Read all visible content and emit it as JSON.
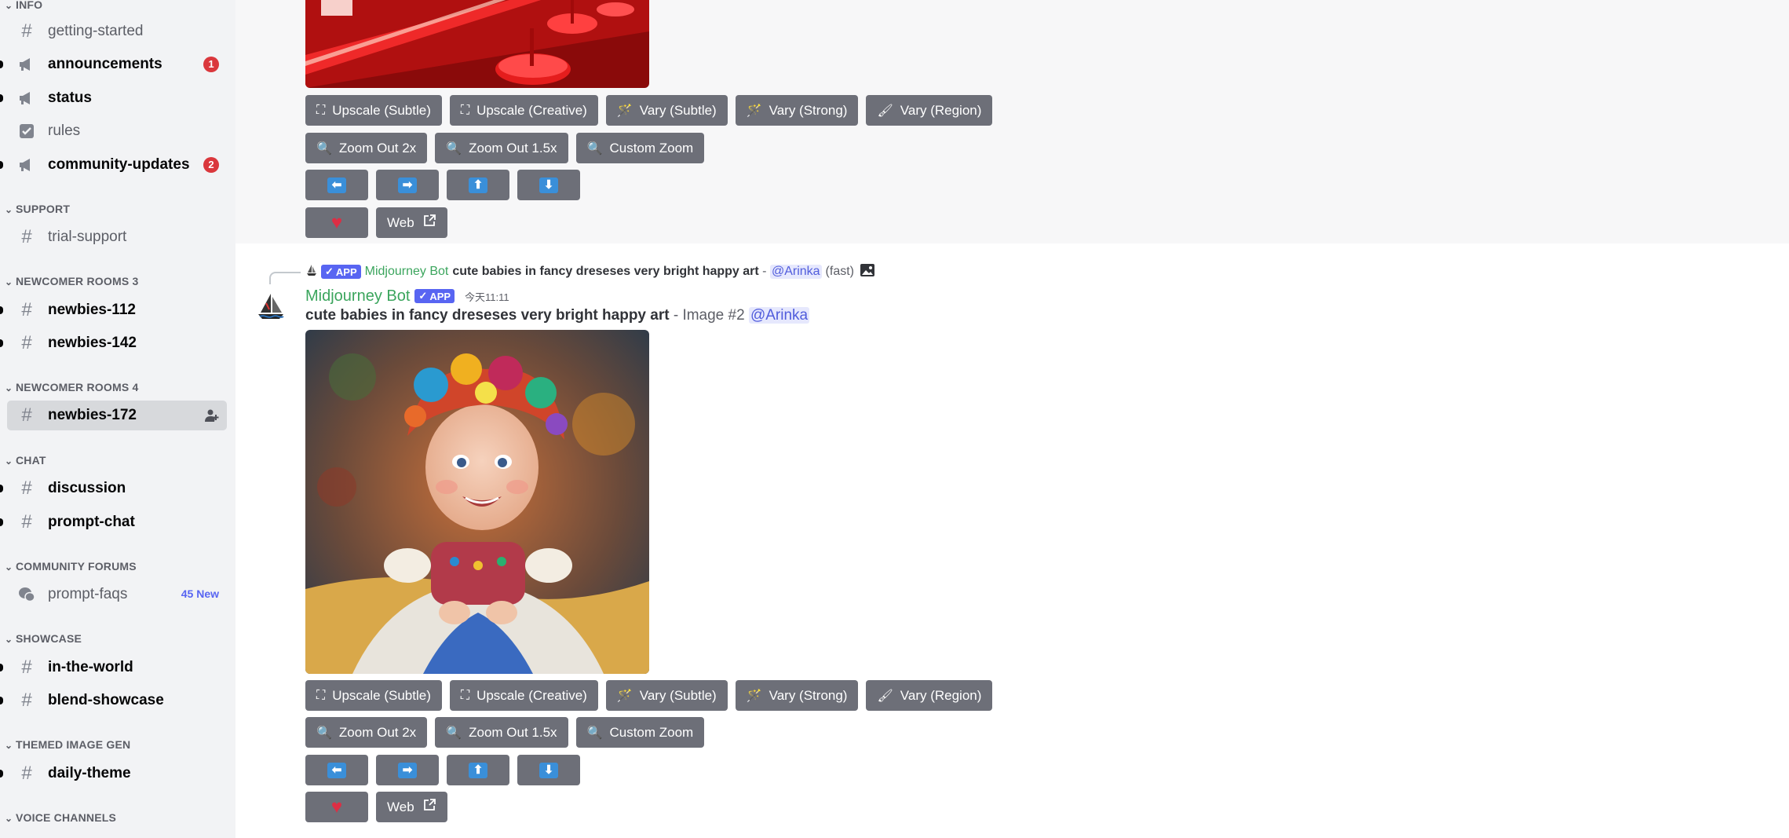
{
  "sidebar": {
    "categories": [
      {
        "label": "INFO"
      },
      {
        "label": "SUPPORT"
      },
      {
        "label": "NEWCOMER ROOMS 3"
      },
      {
        "label": "NEWCOMER ROOMS 4"
      },
      {
        "label": "CHAT"
      },
      {
        "label": "COMMUNITY FORUMS"
      },
      {
        "label": "SHOWCASE"
      },
      {
        "label": "THEMED IMAGE GEN"
      },
      {
        "label": "VOICE CHANNELS"
      }
    ],
    "channels": [
      {
        "name": "getting-started",
        "icon": "hash-icon"
      },
      {
        "name": "announcements",
        "icon": "megaphone-icon",
        "badge": "1"
      },
      {
        "name": "status",
        "icon": "megaphone-icon"
      },
      {
        "name": "rules",
        "icon": "checkbox-icon"
      },
      {
        "name": "community-updates",
        "icon": "megaphone-icon",
        "badge": "2"
      },
      {
        "name": "trial-support",
        "icon": "hash-icon"
      },
      {
        "name": "newbies-112",
        "icon": "hash-icon"
      },
      {
        "name": "newbies-142",
        "icon": "hash-icon"
      },
      {
        "name": "newbies-172",
        "icon": "hash-icon",
        "selected": true
      },
      {
        "name": "discussion",
        "icon": "hash-icon"
      },
      {
        "name": "prompt-chat",
        "icon": "hash-icon"
      },
      {
        "name": "prompt-faqs",
        "icon": "forum-icon",
        "new_tag": "45 New"
      },
      {
        "name": "in-the-world",
        "icon": "hash-icon"
      },
      {
        "name": "blend-showcase",
        "icon": "hash-icon"
      },
      {
        "name": "daily-theme",
        "icon": "hash-icon"
      }
    ]
  },
  "buttons": {
    "upscale_subtle": "Upscale (Subtle)",
    "upscale_creative": "Upscale (Creative)",
    "vary_subtle": "Vary (Subtle)",
    "vary_strong": "Vary (Strong)",
    "vary_region": "Vary (Region)",
    "zoom_out_2x": "Zoom Out 2x",
    "zoom_out_1_5x": "Zoom Out 1.5x",
    "custom_zoom": "Custom Zoom",
    "web": "Web"
  },
  "message2": {
    "reply": {
      "bot_name": "Midjourney Bot",
      "app_tag": "APP",
      "prompt": "cute babies in fancy dreseses very bright happy art",
      "separator": " - ",
      "mention": "@Arinka",
      "speed": "(fast)"
    },
    "author": "Midjourney Bot",
    "app_tag": "APP",
    "timestamp": "今天11:11",
    "prompt": "cute babies in fancy dreseses very bright happy art",
    "image_label": " - Image #2 ",
    "mention": "@Arinka"
  },
  "colors": {
    "accent": "#5865f2",
    "bot_green": "#3ba55d",
    "button_gray": "#6d6f78",
    "badge_red": "#da373c",
    "arrow_blue": "#3a8fd9"
  }
}
